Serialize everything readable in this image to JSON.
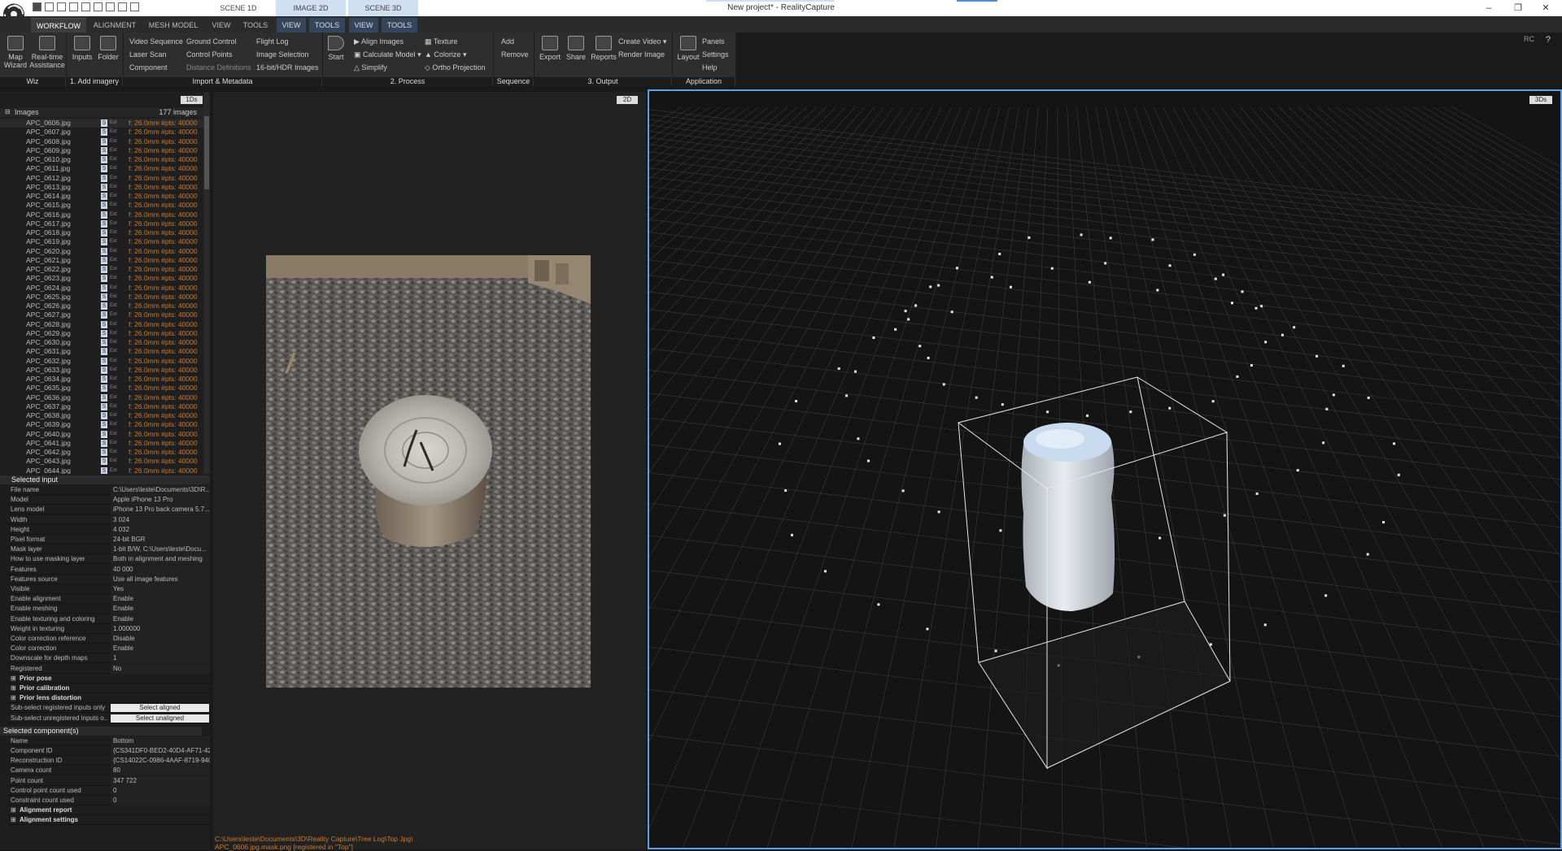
{
  "window": {
    "title": "New project* - RealityCapture",
    "rc": "RC",
    "help": "?"
  },
  "scenes": [
    "SCENE 1D",
    "IMAGE 2D",
    "SCENE 3D"
  ],
  "menu_tabs": [
    "WORKFLOW",
    "ALIGNMENT",
    "MESH MODEL",
    "VIEW",
    "TOOLS",
    "VIEW",
    "TOOLS",
    "VIEW",
    "TOOLS"
  ],
  "ribbon": {
    "wiz": {
      "label": "Wiz",
      "map_wizard": "Map Wizard",
      "realtime": "Real-time Assistance"
    },
    "add": {
      "label": "1. Add imagery",
      "inputs": "Inputs",
      "folder": "Folder"
    },
    "import": {
      "label": "Import & Metadata",
      "items": [
        "Video Sequence",
        "Laser Scan",
        "Component",
        "Ground Control",
        "Control Points",
        "Distance Definitions",
        "Flight Log",
        "Image Selection",
        "16-bit/HDR Images"
      ]
    },
    "process": {
      "label": "2. Process",
      "start": "Start",
      "items": [
        "Align Images",
        "Calculate Model",
        "Simplify",
        "Texture",
        "Colorize",
        "Ortho Projection"
      ]
    },
    "sequence": {
      "label": "Sequence",
      "add": "Add",
      "remove": "Remove"
    },
    "output": {
      "label": "3. Output",
      "export": "Export",
      "share": "Share",
      "reports": "Reports",
      "create_video": "Create Video",
      "render_image": "Render Image"
    },
    "app": {
      "label": "Application",
      "layout": "Layout",
      "panels": "Panels",
      "settings": "Settings",
      "help": "Help"
    }
  },
  "images_panel": {
    "title": "Images",
    "count": "177 images",
    "view_btn": "1Ds",
    "rows": [
      "APC_0606.jpg",
      "APC_0607.jpg",
      "APC_0608.jpg",
      "APC_0609.jpg",
      "APC_0610.jpg",
      "APC_0611.jpg",
      "APC_0612.jpg",
      "APC_0613.jpg",
      "APC_0614.jpg",
      "APC_0615.jpg",
      "APC_0616.jpg",
      "APC_0617.jpg",
      "APC_0618.jpg",
      "APC_0619.jpg",
      "APC_0620.jpg",
      "APC_0621.jpg",
      "APC_0622.jpg",
      "APC_0623.jpg",
      "APC_0624.jpg",
      "APC_0625.jpg",
      "APC_0626.jpg",
      "APC_0627.jpg",
      "APC_0628.jpg",
      "APC_0629.jpg",
      "APC_0630.jpg",
      "APC_0631.jpg",
      "APC_0632.jpg",
      "APC_0633.jpg",
      "APC_0634.jpg",
      "APC_0635.jpg",
      "APC_0636.jpg",
      "APC_0637.jpg",
      "APC_0638.jpg",
      "APC_0639.jpg",
      "APC_0640.jpg",
      "APC_0641.jpg",
      "APC_0642.jpg",
      "APC_0643.jpg",
      "APC_0644.jpg"
    ],
    "badge": "S",
    "badge_ext": "Ext",
    "focal": "f: 26.0mm #pts: 40000"
  },
  "selected_input": {
    "title": "Selected input",
    "props": [
      [
        "File name",
        "C:\\Users\\leste\\Documents\\3D\\R..."
      ],
      [
        "Model",
        "Apple iPhone 13 Pro"
      ],
      [
        "Lens model",
        "iPhone 13 Pro back camera 5.7..."
      ],
      [
        "Width",
        "3 024"
      ],
      [
        "Height",
        "4 032"
      ],
      [
        "Pixel format",
        "24-bit BGR"
      ],
      [
        "Mask layer",
        "1-bit B/W, C:\\Users\\leste\\Docu..."
      ],
      [
        "How to use masking layer",
        "Both in alignment and meshing"
      ],
      [
        "Features",
        "40 000"
      ],
      [
        "Features source",
        "Use all image features"
      ],
      [
        "Visible",
        "Yes"
      ],
      [
        "Enable alignment",
        "Enable"
      ],
      [
        "Enable meshing",
        "Enable"
      ],
      [
        "Enable texturing and coloring",
        "Enable"
      ],
      [
        "Weight in texturing",
        "1.000000"
      ],
      [
        "Color correction reference",
        "Disable"
      ],
      [
        "Color correction",
        "Enable"
      ],
      [
        "Downscale for depth maps",
        "1"
      ],
      [
        "Registered",
        "No"
      ]
    ],
    "sections": [
      "Prior pose",
      "Prior calibration",
      "Prior lens distortion"
    ],
    "subselect": [
      [
        "Sub-select registered inputs only",
        "Select aligned"
      ],
      [
        "Sub-select unregistered inputs o...",
        "Select unaligned"
      ]
    ]
  },
  "selected_component": {
    "title": "Selected component(s)",
    "props": [
      [
        "Name",
        "Bottom"
      ],
      [
        "Component ID",
        "{CS341DF0-BED2-40D4-AF71-42..."
      ],
      [
        "Reconstruction ID",
        "{CS14022C-0986-4AAF-8719-940..."
      ],
      [
        "Camera count",
        "80"
      ],
      [
        "Point count",
        "347 722"
      ],
      [
        "Control point count used",
        "0"
      ],
      [
        "Constraint count used",
        "0"
      ]
    ],
    "sections": [
      "Alignment report",
      "Alignment settings"
    ]
  },
  "view2d": {
    "button": "2D",
    "path_line1": "C:\\Users\\leste\\Documents\\3D\\Reality Capture\\Tree Log\\Top Jpg\\",
    "path_line2": "APC_0606.jpg.mask.png [registered in \"Top\"]"
  },
  "view3d": {
    "button": "3Ds",
    "accent": "#5aa0e6"
  },
  "colors": {
    "orange": "#c87a2e",
    "accent": "#5aa0e6"
  }
}
